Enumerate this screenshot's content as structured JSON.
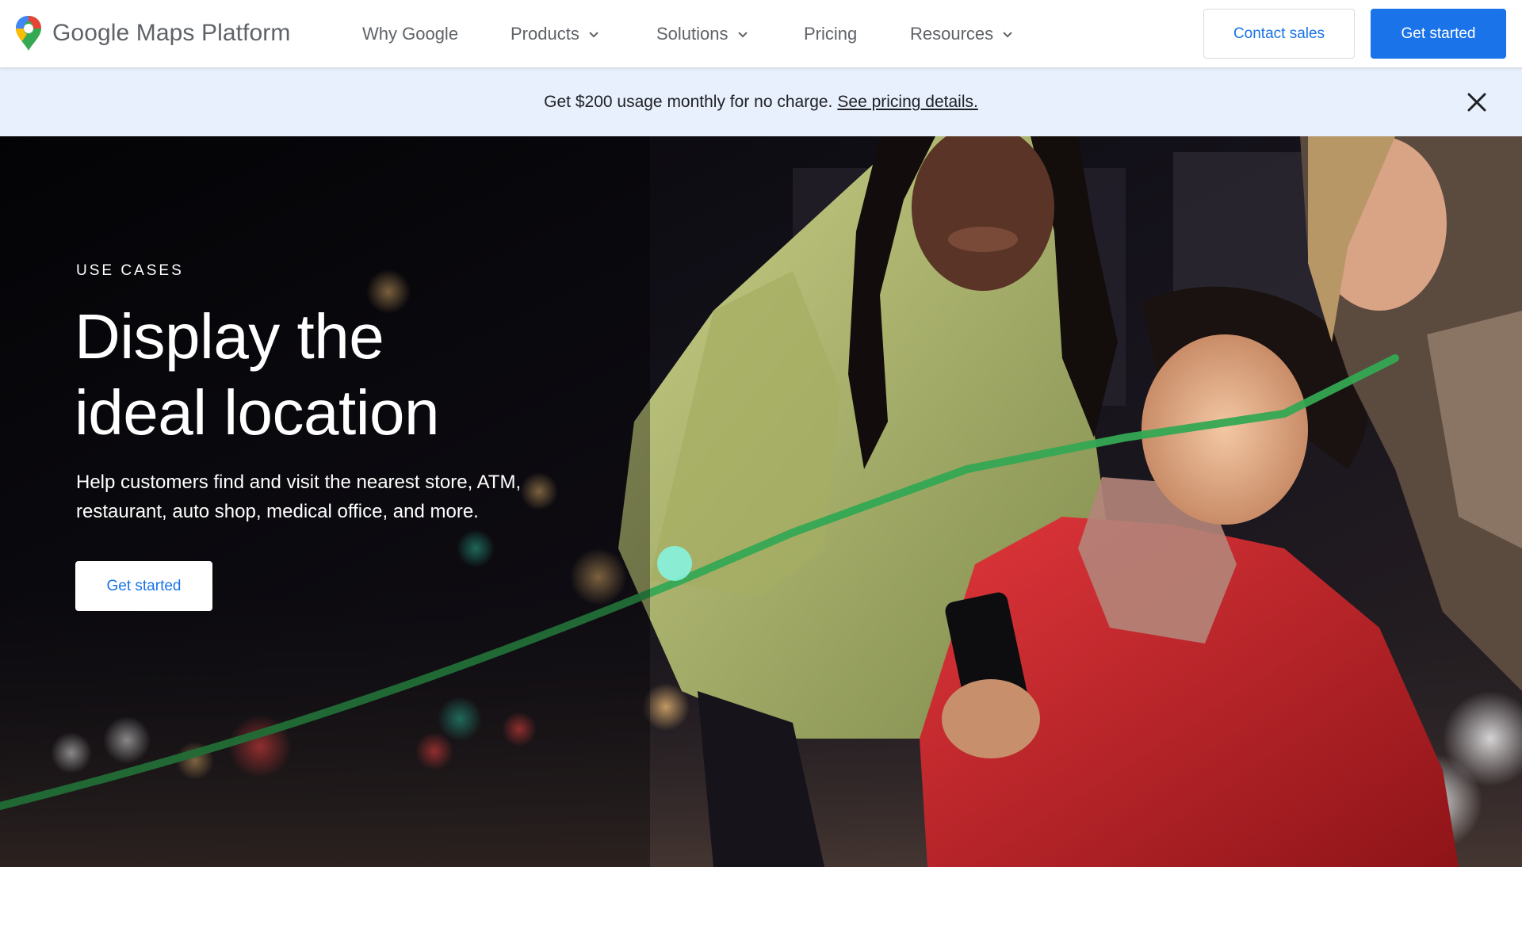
{
  "header": {
    "brand_name": "Google Maps Platform",
    "logo_icon": "google-maps-pin-icon",
    "nav": [
      {
        "label": "Why Google",
        "has_dropdown": false
      },
      {
        "label": "Products",
        "has_dropdown": true
      },
      {
        "label": "Solutions",
        "has_dropdown": true
      },
      {
        "label": "Pricing",
        "has_dropdown": false
      },
      {
        "label": "Resources",
        "has_dropdown": true
      }
    ],
    "contact_sales_label": "Contact sales",
    "get_started_label": "Get started"
  },
  "promo": {
    "text": "Get $200 usage monthly for no charge.",
    "link_text": "See pricing details.",
    "close_icon": "close-icon"
  },
  "hero": {
    "eyebrow": "USE CASES",
    "title_line1": "Display the",
    "title_line2": "ideal location",
    "description": "Help customers find and visit the nearest store, ATM, restaurant, auto shop, medical office, and more.",
    "cta_label": "Get started",
    "image": "photo of three people at night looking at a smartphone with a green route line"
  },
  "colors": {
    "brand_blue": "#1a73e8",
    "promo_bg": "#e8f0fe",
    "route_green": "#34a853",
    "text_gray": "#5f6368"
  }
}
